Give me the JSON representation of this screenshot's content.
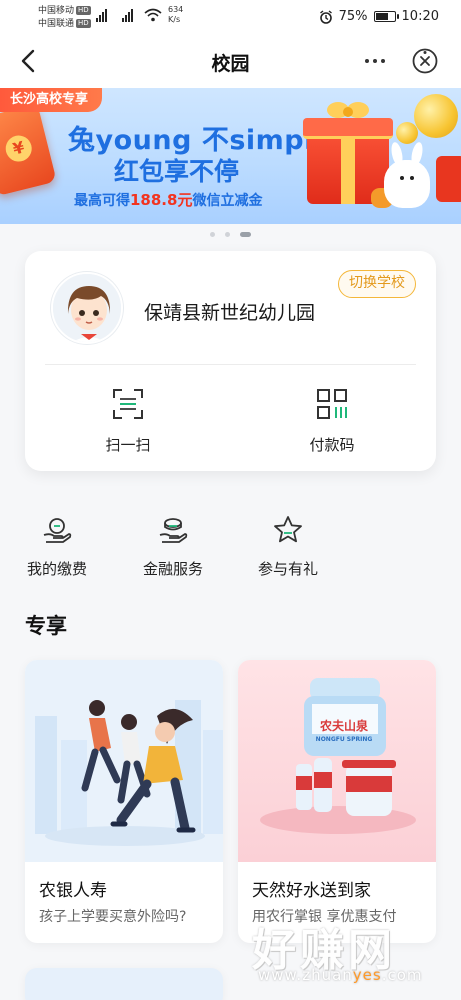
{
  "status_bar": {
    "carrier1": "中国移动",
    "carrier2": "中国联通",
    "hd": "HD",
    "net_type": "4G",
    "speed_value": "634",
    "speed_unit": "K/s",
    "battery": "75%",
    "battery_level": 0.75,
    "time": "10:20"
  },
  "navbar": {
    "title": "校园"
  },
  "banner": {
    "tag": "长沙高校专享",
    "line1": "兔young 不simple",
    "line2": "红包享不停",
    "line3_prefix": "最高可得",
    "line3_amount": "188.8元",
    "line3_suffix": "微信立减金",
    "slide_count": 3,
    "active_slide": 3
  },
  "profile_card": {
    "school_name": "保靖县新世纪幼儿园",
    "switch_label": "切换学校",
    "scan_label": "扫一扫",
    "pay_code_label": "付款码"
  },
  "shortcuts": [
    {
      "label": "我的缴费",
      "icon": "payment-hand-icon"
    },
    {
      "label": "金融服务",
      "icon": "finance-hand-icon"
    },
    {
      "label": "参与有礼",
      "icon": "star-icon"
    }
  ],
  "section": {
    "title": "专享"
  },
  "products": [
    {
      "title": "农银人寿",
      "subtitle": "孩子上学要买意外险吗?"
    },
    {
      "title": "天然好水送到家",
      "subtitle": "用农行掌银 享优惠支付",
      "brand_cn": "农夫山泉",
      "brand_en": "NONGFU SPRING"
    }
  ],
  "watermark": {
    "text": "好赚网",
    "url_prefix": "www.zhuan",
    "url_highlight": "yes",
    "url_suffix": ".com"
  },
  "colors": {
    "accent_blue": "#1f6fe0",
    "accent_orange": "#e39a1d",
    "banner_red": "#f2331f",
    "bg": "#f6f7f9"
  }
}
